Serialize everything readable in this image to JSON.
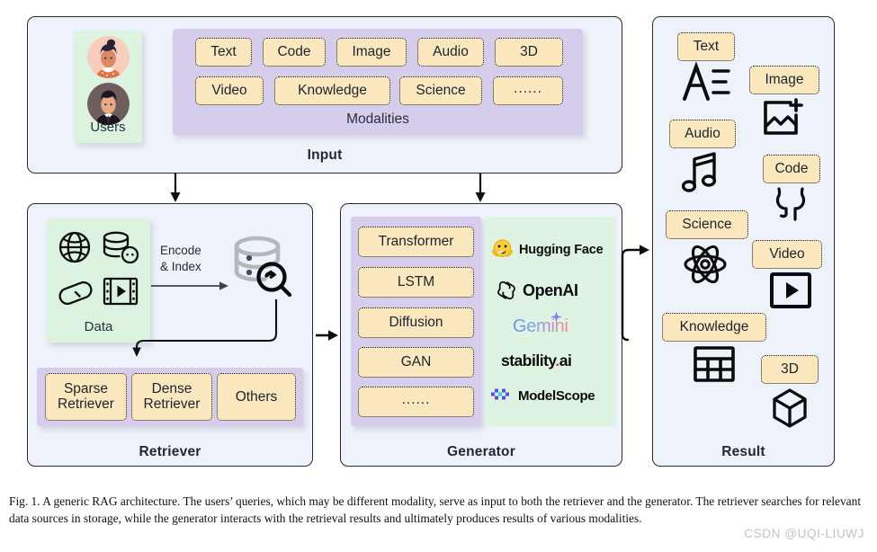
{
  "figure": {
    "caption": "Fig. 1.  A generic RAG architecture. The users’ queries, which may be different modality, serve as input to both the retriever and the generator. The retriever searches for relevant data sources in storage, while the generator interacts with the retrieval results and ultimately produces results of various modalities.",
    "watermark": "CSDN @UQI-LIUWJ"
  },
  "colors": {
    "panel_bg": "#eef2fb",
    "panel_border": "#2b2b2b",
    "purple_group": "#d6cdec",
    "green_group": "#dcf3df",
    "tag_fill": "#fbe8bf",
    "tag_border": "#15181d",
    "text": "#1f2430"
  },
  "input": {
    "title": "Input",
    "users": {
      "label": "Users",
      "avatars": [
        "user-avatar-female",
        "user-avatar-male"
      ]
    },
    "modalities": {
      "label": "Modalities",
      "row1": [
        "Text",
        "Code",
        "Image",
        "Audio",
        "3D"
      ],
      "row2": [
        "Video",
        "Knowledge",
        "Science",
        "......"
      ]
    }
  },
  "retriever": {
    "title": "Retriever",
    "data": {
      "label": "Data",
      "icons": [
        "globe-icon",
        "database-icon",
        "capsule-icon",
        "film-icon"
      ]
    },
    "encode_arrow_label_line1": "Encode",
    "encode_arrow_label_line2": "& Index",
    "storage_icon": "database-search-icon",
    "retrievers": [
      {
        "line1": "Sparse",
        "line2": "Retriever"
      },
      {
        "line1": "Dense",
        "line2": "Retriever"
      },
      {
        "line1": "Others",
        "line2": ""
      }
    ]
  },
  "generator": {
    "title": "Generator",
    "models": [
      "Transformer",
      "LSTM",
      "Diffusion",
      "GAN",
      "......"
    ],
    "brands": [
      {
        "name": "Hugging Face",
        "icon": "hugging-face-icon"
      },
      {
        "name": "OpenAI",
        "icon": "openai-icon"
      },
      {
        "name": "Gemini",
        "icon": "gemini-sparkle-icon"
      },
      {
        "name": "stability.ai",
        "icon": "stability-ai-icon"
      },
      {
        "name": "ModelScope",
        "icon": "modelscope-icon"
      }
    ]
  },
  "result": {
    "title": "Result",
    "items": [
      {
        "label": "Text",
        "icon": "text-format-icon"
      },
      {
        "label": "Image",
        "icon": "image-add-icon"
      },
      {
        "label": "Audio",
        "icon": "music-note-icon"
      },
      {
        "label": "Code",
        "icon": "github-icon"
      },
      {
        "label": "Science",
        "icon": "atom-icon"
      },
      {
        "label": "Video",
        "icon": "video-play-icon"
      },
      {
        "label": "Knowledge",
        "icon": "table-grid-icon"
      },
      {
        "label": "3D",
        "icon": "cube-icon"
      }
    ]
  }
}
